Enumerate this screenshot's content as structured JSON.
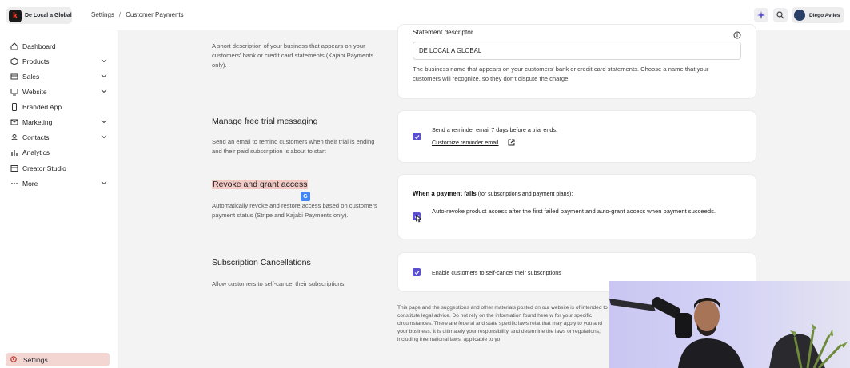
{
  "topbar": {
    "brand_name": "De Local a Global",
    "breadcrumb": [
      "Settings",
      "/",
      "Customer Payments"
    ],
    "user_name": "Diego Avilés"
  },
  "sidebar": {
    "items": [
      {
        "label": "Dashboard",
        "icon": "home-icon",
        "chevron": false
      },
      {
        "label": "Products",
        "icon": "box-icon",
        "chevron": true
      },
      {
        "label": "Sales",
        "icon": "card-icon",
        "chevron": true
      },
      {
        "label": "Website",
        "icon": "monitor-icon",
        "chevron": true
      },
      {
        "label": "Branded App",
        "icon": "phone-icon",
        "chevron": false
      },
      {
        "label": "Marketing",
        "icon": "mail-icon",
        "chevron": true
      },
      {
        "label": "Contacts",
        "icon": "contacts-icon",
        "chevron": true
      },
      {
        "label": "Analytics",
        "icon": "chart-icon",
        "chevron": false
      },
      {
        "label": "Creator Studio",
        "icon": "studio-icon",
        "chevron": false
      },
      {
        "label": "More",
        "icon": "more-icon",
        "chevron": true
      }
    ],
    "settings_label": "Settings"
  },
  "statement": {
    "left_desc": "A short description of your business that appears on your customers' bank or credit card statements (Kajabi Payments only).",
    "field_label": "Statement descriptor",
    "field_value": "DE LOCAL A GLOBAL",
    "help": "The business name that appears on your customers' bank or credit card statements. Choose a name that your customers will recognize, so they don't dispute the charge."
  },
  "trial": {
    "title": "Manage free trial messaging",
    "desc": "Send an email to remind customers when their trial is ending and their paid subscription is about to start",
    "checkbox_label": "Send a reminder email 7 days before a trial ends.",
    "link": "Customize reminder email"
  },
  "access": {
    "title": "Revoke and grant access",
    "desc": "Automatically revoke and restore access based on customers payment status (Stripe and Kajabi Payments only).",
    "when_bold": "When a payment fails",
    "when_rest": " (for subscriptions and payment plans):",
    "checkbox_label": "Auto-revoke product access after the first failed payment and auto-grant access when payment succeeds."
  },
  "cancel": {
    "title": "Subscription Cancellations",
    "desc": "Allow customers to self-cancel their subscriptions.",
    "checkbox_label": "Enable customers to self-cancel their subscriptions"
  },
  "disclaimer": "This page and the suggestions and other materials posted on our website is of intended to constitute legal advice. Do not rely on the information found here w for your specific circumstances. There are federal and state specific laws relat that may apply to you and your business. It is ultimately your responsibility, and determine the laws or regulations, including international laws, applicable to yo",
  "colors": {
    "accent": "#5a4fcf",
    "highlight": "#f3c9c6",
    "settings_bg": "#f3d5d2"
  }
}
